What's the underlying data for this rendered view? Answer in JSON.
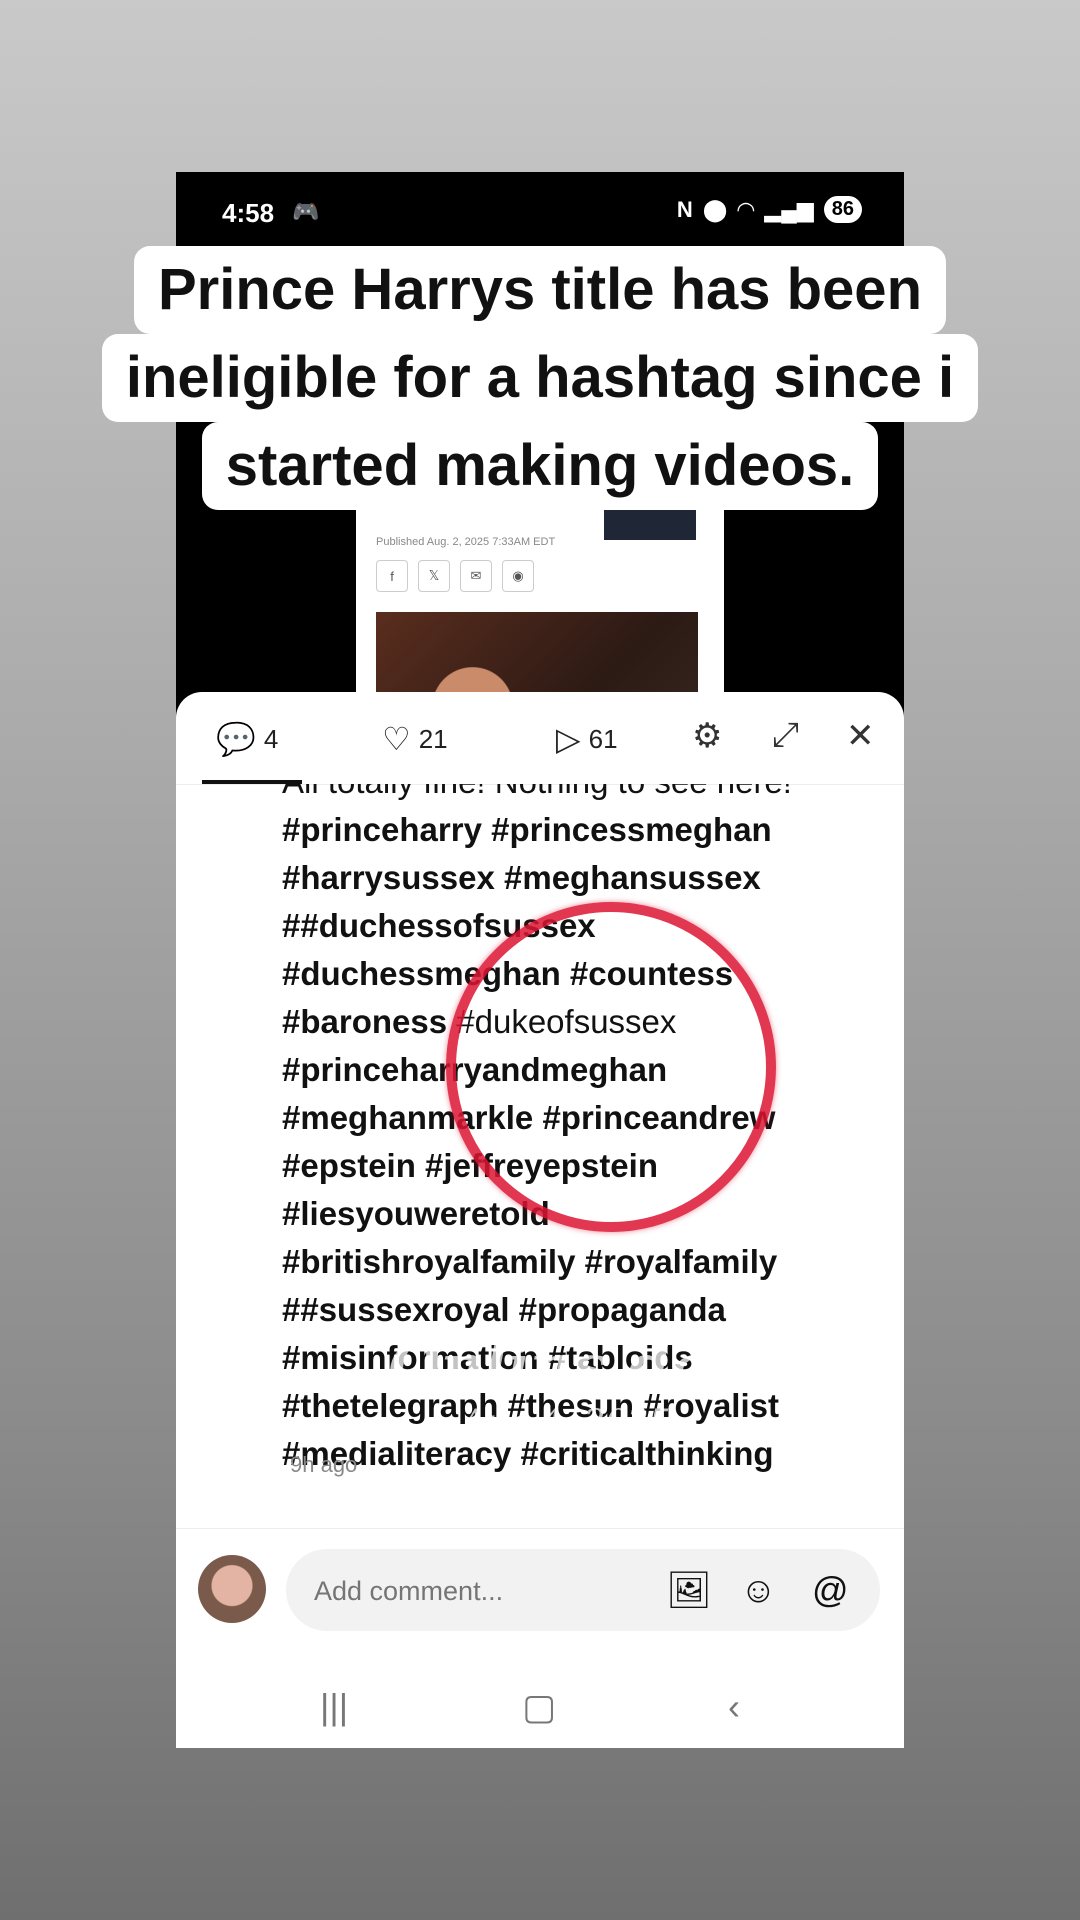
{
  "status_bar": {
    "time": "4:58",
    "game_icon": "gamepad-icon",
    "nfc_icon": "N",
    "location_icon": "location-icon",
    "wifi_icon": "wifi-icon",
    "signal_icon": "signal-icon",
    "battery": "86"
  },
  "caption": {
    "line1": "Prince Harrys title has been",
    "line2": "ineligible for a hashtag since i",
    "line3": "started making videos."
  },
  "article": {
    "meta": "Published Aug. 2, 2025 7:33AM EDT",
    "share_buttons": [
      "f",
      "𝕏",
      "✉",
      "◉"
    ]
  },
  "tabs": {
    "comments_count": "4",
    "likes_count": "21",
    "plays_count": "61"
  },
  "comment": {
    "clipped_line": "All totally fine! Nothing to see here!",
    "lines": [
      "#princeharry #princessmeghan",
      "#harrysussex #meghansussex",
      "##duchessofsussex",
      "#duchessmeghan #countess"
    ],
    "line_baroness": "#baroness",
    "line_duke": "#dukeofsussex",
    "lines2": [
      "#princeharryandmeghan",
      "#meghanmarkle #princeandrew",
      "#epstein #jeffreyepstein",
      "#liesyouweretold",
      "#britishroyalfamily #royalfamily",
      "##sussexroyal #propaganda",
      "#misinformation #tabloids",
      "#thetelegraph #thesun #royalist",
      "#medialiteracy #criticalthinking"
    ],
    "timestamp": "9h ago"
  },
  "watermark": {
    "line1": "Onlins day",
    "line2": "Aug 4, 2025"
  },
  "input": {
    "placeholder": "Add comment..."
  },
  "colors": {
    "ring": "#dc1432",
    "sheet": "#ffffff",
    "field": "#f2f2f2"
  }
}
